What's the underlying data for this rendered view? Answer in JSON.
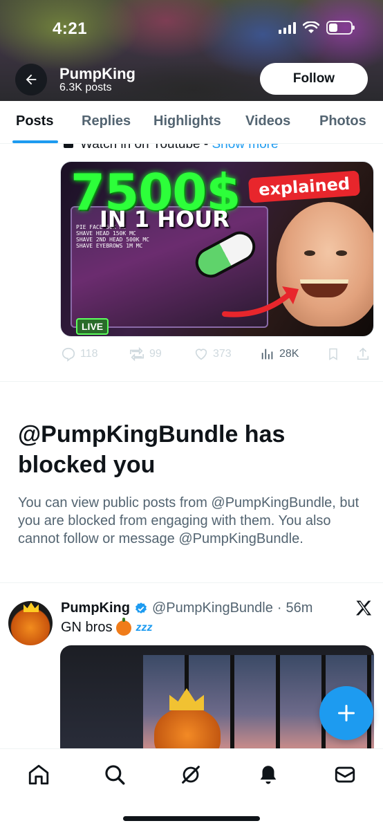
{
  "status_bar": {
    "time": "4:21"
  },
  "header": {
    "name": "PumpKing",
    "post_count": "6.3K posts",
    "follow_label": "Follow"
  },
  "tabs": [
    {
      "label": "Posts",
      "active": true
    },
    {
      "label": "Replies",
      "active": false
    },
    {
      "label": "Highlights",
      "active": false
    },
    {
      "label": "Videos",
      "active": false
    },
    {
      "label": "Photos",
      "active": false
    }
  ],
  "post1": {
    "cut_text": "Watch in on Youtube - ",
    "show_more": "Show more",
    "thumbnail": {
      "headline": "7500$",
      "subline": "IN 1 HOUR",
      "badge": "explained",
      "notes": [
        "PIE FACE 50K MC",
        "SHAVE HEAD 150K MC",
        "SHAVE 2ND HEAD 500K MC",
        "SHAVE EYEBROWS 1M MC"
      ],
      "live_label": "LIVE"
    },
    "actions": {
      "replies": "118",
      "reposts": "99",
      "likes": "373",
      "views": "28K"
    }
  },
  "blocked_notice": {
    "title": "@PumpKingBundle has blocked you",
    "body": "You can view public posts from @PumpKingBundle, but you are blocked from engaging with them. You also cannot follow or message @PumpKingBundle."
  },
  "post2": {
    "author": "PumpKing",
    "handle": "@PumpKingBundle",
    "separator": "·",
    "time": "56m",
    "text": "GN bros",
    "zzz": "zzz"
  },
  "colors": {
    "accent": "#1d9bf0",
    "text_primary": "#0f1419",
    "text_secondary": "#536471",
    "divider": "#eff3f4"
  },
  "bottom_nav": [
    {
      "icon": "home-icon"
    },
    {
      "icon": "search-icon"
    },
    {
      "icon": "grok-icon"
    },
    {
      "icon": "notifications-icon"
    },
    {
      "icon": "messages-icon"
    }
  ]
}
